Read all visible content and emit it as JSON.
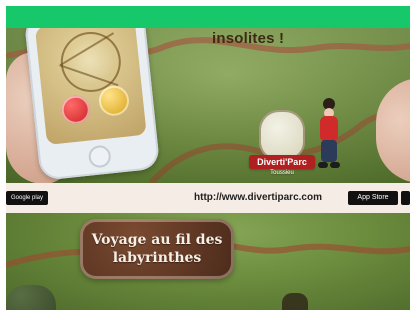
{
  "panel1": {
    "headline": "insolites !",
    "logo": {
      "name": "Diverti'Parc",
      "sub": "Toussieu"
    }
  },
  "strip": {
    "url": "http://www.divertiparc.com",
    "badges": {
      "left": "Google play",
      "right": "App Store"
    }
  },
  "panel2": {
    "sign_line1": "Voyage au fil des",
    "sign_line2": "labyrinthes"
  },
  "colors": {
    "topbar": "#16c86a",
    "path": "#9a4b2f",
    "sign": "#4b2a1b"
  }
}
